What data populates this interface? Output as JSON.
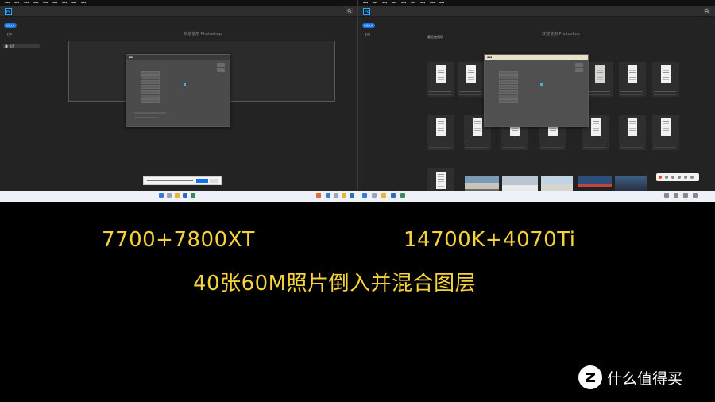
{
  "screens": {
    "left": {
      "welcome": "欢迎使用 Photoshop"
    },
    "right": {
      "welcome": "欢迎使用 Photoshop",
      "section_title": "最近使用项"
    }
  },
  "app": {
    "logo": "Ps",
    "new_button": "新建文件",
    "open_link": "打开",
    "home": "主页"
  },
  "captions": {
    "left_config": "7700+7800XT",
    "right_config": "14700K+4070Ti",
    "task": "40张60M照片倒入并混合图层"
  },
  "watermark": {
    "text": "什么值得买",
    "logo_color": "#ffffff"
  },
  "colors": {
    "caption": "#f6d33c",
    "accent": "#1473e6",
    "ps_blue": "#31a8ff"
  }
}
